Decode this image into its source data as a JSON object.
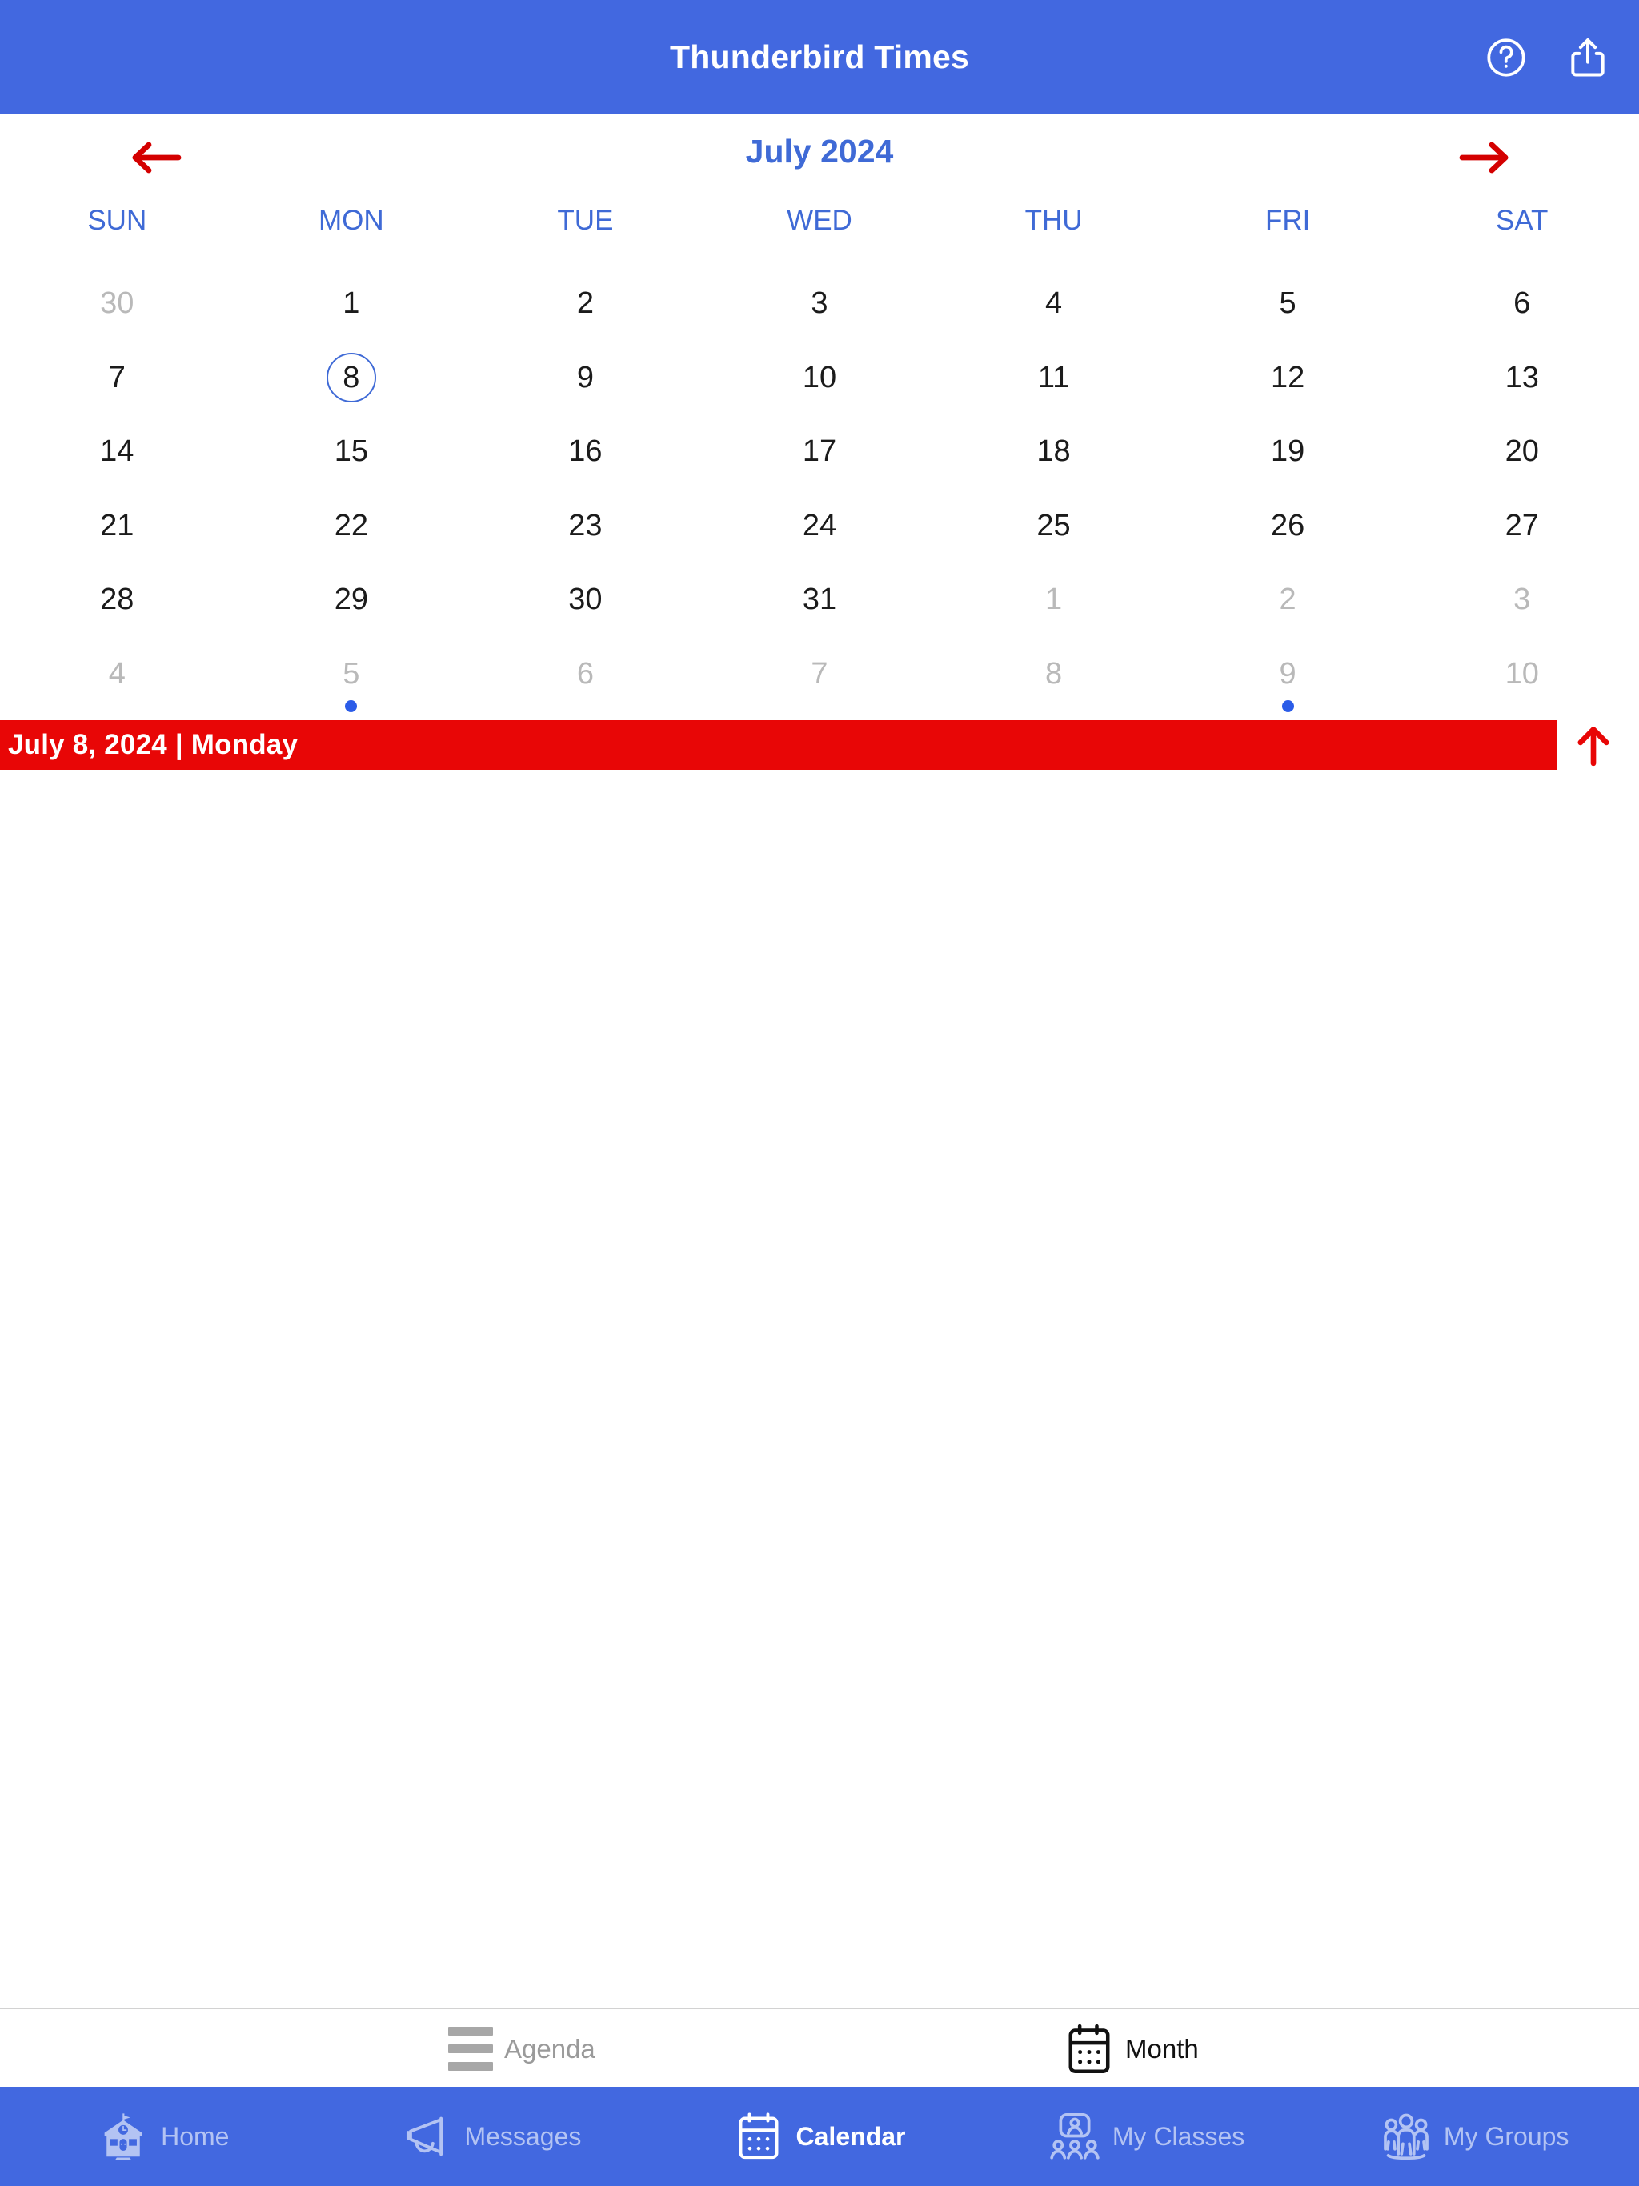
{
  "appbar": {
    "title": "Thunderbird Times",
    "help_icon": "help-circle-icon",
    "share_icon": "share-icon"
  },
  "calendar": {
    "month_title": "July 2024",
    "prev_label": "←",
    "next_label": "→",
    "weekdays": [
      "SUN",
      "MON",
      "TUE",
      "WED",
      "THU",
      "FRI",
      "SAT"
    ],
    "accent_blue": "#3f6ad6",
    "arrow_red": "#d40000",
    "dot_color": "#2b5ce8",
    "weeks": [
      [
        {
          "day": "30",
          "muted": true,
          "selected": false,
          "dot": false
        },
        {
          "day": "1",
          "muted": false,
          "selected": false,
          "dot": false
        },
        {
          "day": "2",
          "muted": false,
          "selected": false,
          "dot": false
        },
        {
          "day": "3",
          "muted": false,
          "selected": false,
          "dot": false
        },
        {
          "day": "4",
          "muted": false,
          "selected": false,
          "dot": false
        },
        {
          "day": "5",
          "muted": false,
          "selected": false,
          "dot": false
        },
        {
          "day": "6",
          "muted": false,
          "selected": false,
          "dot": false
        }
      ],
      [
        {
          "day": "7",
          "muted": false,
          "selected": false,
          "dot": false
        },
        {
          "day": "8",
          "muted": false,
          "selected": true,
          "dot": false
        },
        {
          "day": "9",
          "muted": false,
          "selected": false,
          "dot": false
        },
        {
          "day": "10",
          "muted": false,
          "selected": false,
          "dot": false
        },
        {
          "day": "11",
          "muted": false,
          "selected": false,
          "dot": false
        },
        {
          "day": "12",
          "muted": false,
          "selected": false,
          "dot": false
        },
        {
          "day": "13",
          "muted": false,
          "selected": false,
          "dot": false
        }
      ],
      [
        {
          "day": "14",
          "muted": false,
          "selected": false,
          "dot": false
        },
        {
          "day": "15",
          "muted": false,
          "selected": false,
          "dot": false
        },
        {
          "day": "16",
          "muted": false,
          "selected": false,
          "dot": false
        },
        {
          "day": "17",
          "muted": false,
          "selected": false,
          "dot": false
        },
        {
          "day": "18",
          "muted": false,
          "selected": false,
          "dot": false
        },
        {
          "day": "19",
          "muted": false,
          "selected": false,
          "dot": false
        },
        {
          "day": "20",
          "muted": false,
          "selected": false,
          "dot": false
        }
      ],
      [
        {
          "day": "21",
          "muted": false,
          "selected": false,
          "dot": false
        },
        {
          "day": "22",
          "muted": false,
          "selected": false,
          "dot": false
        },
        {
          "day": "23",
          "muted": false,
          "selected": false,
          "dot": false
        },
        {
          "day": "24",
          "muted": false,
          "selected": false,
          "dot": false
        },
        {
          "day": "25",
          "muted": false,
          "selected": false,
          "dot": false
        },
        {
          "day": "26",
          "muted": false,
          "selected": false,
          "dot": false
        },
        {
          "day": "27",
          "muted": false,
          "selected": false,
          "dot": false
        }
      ],
      [
        {
          "day": "28",
          "muted": false,
          "selected": false,
          "dot": false
        },
        {
          "day": "29",
          "muted": false,
          "selected": false,
          "dot": false
        },
        {
          "day": "30",
          "muted": false,
          "selected": false,
          "dot": false
        },
        {
          "day": "31",
          "muted": false,
          "selected": false,
          "dot": false
        },
        {
          "day": "1",
          "muted": true,
          "selected": false,
          "dot": false
        },
        {
          "day": "2",
          "muted": true,
          "selected": false,
          "dot": false
        },
        {
          "day": "3",
          "muted": true,
          "selected": false,
          "dot": false
        }
      ],
      [
        {
          "day": "4",
          "muted": true,
          "selected": false,
          "dot": false
        },
        {
          "day": "5",
          "muted": true,
          "selected": false,
          "dot": true
        },
        {
          "day": "6",
          "muted": true,
          "selected": false,
          "dot": false
        },
        {
          "day": "7",
          "muted": true,
          "selected": false,
          "dot": false
        },
        {
          "day": "8",
          "muted": true,
          "selected": false,
          "dot": false
        },
        {
          "day": "9",
          "muted": true,
          "selected": false,
          "dot": true
        },
        {
          "day": "10",
          "muted": true,
          "selected": false,
          "dot": false
        }
      ]
    ]
  },
  "selected_day_bar": {
    "text": "July 8, 2024 | Monday",
    "background": "#e80606",
    "collapse_icon": "arrow-up-icon"
  },
  "view_switcher": {
    "tabs": [
      {
        "label": "Agenda",
        "icon": "list-lines-icon",
        "active": false
      },
      {
        "label": "Month",
        "icon": "calendar-grid-icon",
        "active": true
      }
    ]
  },
  "bottom_nav": {
    "background": "#4268e0",
    "items": [
      {
        "label": "Home",
        "icon": "school-building-icon",
        "active": false
      },
      {
        "label": "Messages",
        "icon": "megaphone-icon",
        "active": false
      },
      {
        "label": "Calendar",
        "icon": "calendar-icon",
        "active": true
      },
      {
        "label": "My Classes",
        "icon": "classroom-people-icon",
        "active": false
      },
      {
        "label": "My Groups",
        "icon": "group-people-icon",
        "active": false
      }
    ]
  }
}
